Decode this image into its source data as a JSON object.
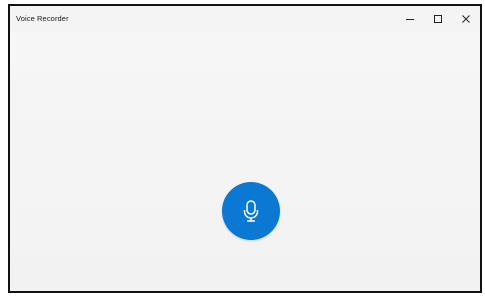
{
  "window": {
    "title": "Voice Recorder"
  },
  "caption_buttons": [
    {
      "name": "minimize",
      "icon": "minimize-icon"
    },
    {
      "name": "maximize",
      "icon": "maximize-icon"
    },
    {
      "name": "close",
      "icon": "close-icon"
    }
  ],
  "record": {
    "icon": "microphone-icon",
    "color": "#0b78d4"
  }
}
